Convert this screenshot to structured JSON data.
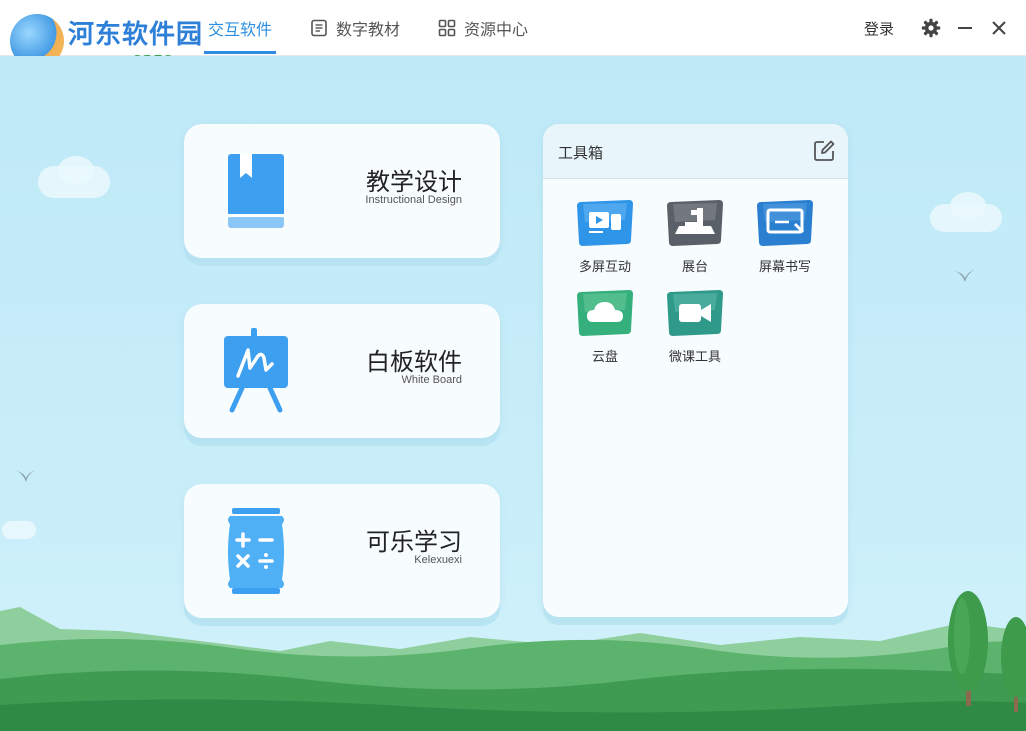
{
  "logo": {
    "brand_text": "河东软件园",
    "url_text": "www.pc0359.cn"
  },
  "nav": {
    "tabs": [
      {
        "label": "交互软件",
        "icon": "interactive-icon",
        "active": true
      },
      {
        "label": "数字教材",
        "icon": "book-icon",
        "active": false
      },
      {
        "label": "资源中心",
        "icon": "grid-icon",
        "active": false
      }
    ],
    "login_label": "登录",
    "accent": "#2d8fe3"
  },
  "cards": [
    {
      "title": "教学设计",
      "subtitle": "Instructional Design",
      "icon": "bookmark-book-icon"
    },
    {
      "title": "白板软件",
      "subtitle": "White Board",
      "icon": "whiteboard-easel-icon"
    },
    {
      "title": "可乐学习",
      "subtitle": "Kelexuexi",
      "icon": "calculator-can-icon"
    }
  ],
  "toolbox": {
    "title": "工具箱",
    "tools": [
      {
        "label": "多屏互动",
        "icon": "multi-screen-icon",
        "color": "#2f95e8"
      },
      {
        "label": "展台",
        "icon": "document-camera-icon",
        "color": "#555a60"
      },
      {
        "label": "屏幕书写",
        "icon": "screen-write-icon",
        "color": "#2a7fd0"
      },
      {
        "label": "云盘",
        "icon": "cloud-disk-icon",
        "color": "#35b07c"
      },
      {
        "label": "微课工具",
        "icon": "video-camera-icon",
        "color": "#2f9a8a"
      }
    ]
  }
}
